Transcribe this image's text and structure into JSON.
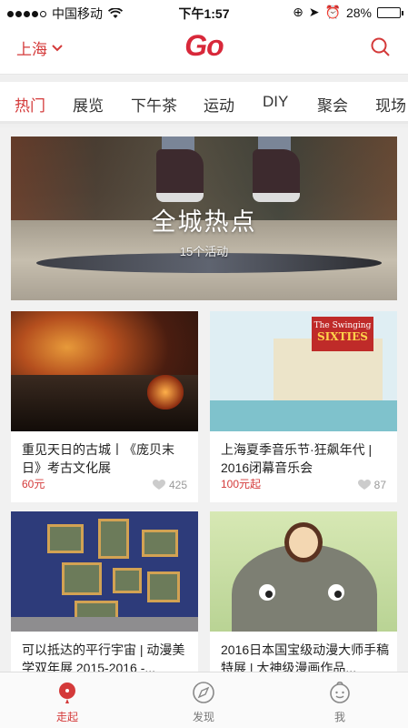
{
  "status_bar": {
    "carrier": "中国移动",
    "time": "下午1:57",
    "battery": "28%",
    "battery_level": 0.28
  },
  "header": {
    "city": "上海",
    "logo": "Go"
  },
  "tabs": [
    {
      "label": "热门",
      "active": true
    },
    {
      "label": "展览"
    },
    {
      "label": "下午茶"
    },
    {
      "label": "运动"
    },
    {
      "label": "DIY"
    },
    {
      "label": "聚会"
    },
    {
      "label": "现场"
    }
  ],
  "banner": {
    "title": "全城热点",
    "subtitle": "15个活动"
  },
  "cards": [
    {
      "title": "重见天日的古城丨《庞贝末日》考古文化展",
      "price": "60元",
      "likes": "425"
    },
    {
      "title": "上海夏季音乐节·狂飙年代 | 2016闭幕音乐会",
      "price": "100元起",
      "likes": "87",
      "image_sign_small": "The Swinging",
      "image_sign_big": "SIXTIES"
    },
    {
      "title": "可以抵达的平行宇宙 | 动漫美学双年展 2015-2016 -...",
      "price": "",
      "likes": ""
    },
    {
      "title": "2016日本国宝级动漫大师手稿特展 | 大神级漫画作品...",
      "price": "",
      "likes": ""
    }
  ],
  "bottom_nav": [
    {
      "label": "走起",
      "active": true,
      "icon": "balloon-icon"
    },
    {
      "label": "发现",
      "icon": "compass-icon"
    },
    {
      "label": "我",
      "icon": "face-icon"
    }
  ],
  "colors": {
    "accent": "#d43a3a",
    "logo": "#d8283a"
  }
}
